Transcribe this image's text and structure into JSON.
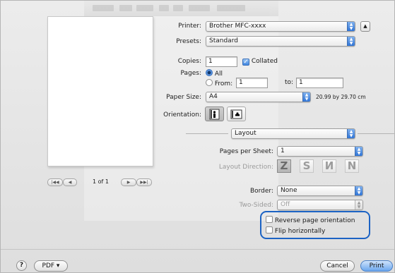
{
  "printer": {
    "label": "Printer:",
    "value": "Brother MFC-xxxx"
  },
  "presets": {
    "label": "Presets:",
    "value": "Standard"
  },
  "copies": {
    "label": "Copies:",
    "value": "1",
    "collated_label": "Collated",
    "collated": true
  },
  "pages": {
    "label": "Pages:",
    "all_label": "All",
    "from_label": "From:",
    "from_value": "1",
    "to_label": "to:",
    "to_value": "1",
    "selected": "all"
  },
  "paper_size": {
    "label": "Paper Size:",
    "value": "A4",
    "dimensions": "20.99 by 29.70 cm"
  },
  "orientation": {
    "label": "Orientation:"
  },
  "section": {
    "value": "Layout"
  },
  "layout": {
    "pages_per_sheet_label": "Pages per Sheet:",
    "pages_per_sheet_value": "1",
    "layout_direction_label": "Layout Direction:",
    "border_label": "Border:",
    "border_value": "None",
    "two_sided_label": "Two-Sided:",
    "two_sided_value": "Off",
    "reverse_label": "Reverse page orientation",
    "flip_label": "Flip horizontally"
  },
  "preview": {
    "page_counter": "1 of 1"
  },
  "footer": {
    "help": "?",
    "pdf": "PDF ▾",
    "cancel": "Cancel",
    "print": "Print"
  },
  "colors": {
    "highlight": "#1c63c4",
    "button_blue": "#6aa6ee"
  }
}
